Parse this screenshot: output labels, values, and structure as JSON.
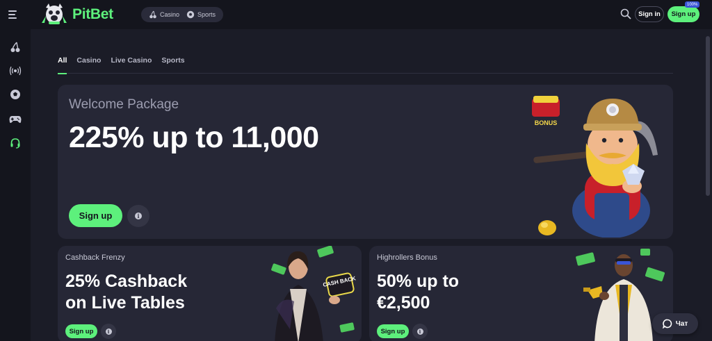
{
  "header": {
    "brand": "PitBet",
    "nav": [
      {
        "label": "Casino",
        "icon": "cherries-icon"
      },
      {
        "label": "Sports",
        "icon": "soccer-ball-icon"
      }
    ],
    "signin_label": "Sign in",
    "signup_label": "Sign up",
    "badge": "100%"
  },
  "sidebar": {
    "items": [
      {
        "icon": "cherries-icon"
      },
      {
        "icon": "live-broadcast-icon"
      },
      {
        "icon": "soccer-ball-icon"
      },
      {
        "icon": "gamepad-icon"
      },
      {
        "icon": "headset-icon"
      }
    ]
  },
  "tabs": [
    "All",
    "Casino",
    "Live Casino",
    "Sports"
  ],
  "hero": {
    "subtitle": "Welcome Package",
    "title": "225% up to 11,000",
    "signup_label": "Sign up",
    "art_label": "BONUS"
  },
  "promos": [
    {
      "subtitle": "Cashback Frenzy",
      "title_line1": "25% Cashback",
      "title_line2": "on Live Tables",
      "signup_label": "Sign up",
      "art_label": "CASH BACK"
    },
    {
      "subtitle": "Highrollers Bonus",
      "title_line1": "50% up to",
      "title_line2": "€2,500",
      "signup_label": "Sign up"
    }
  ],
  "chat": {
    "label": "Чат"
  },
  "colors": {
    "accent": "#5df07c",
    "background": "#1b1c27",
    "card": "#262736",
    "sidebar": "#14151d"
  }
}
